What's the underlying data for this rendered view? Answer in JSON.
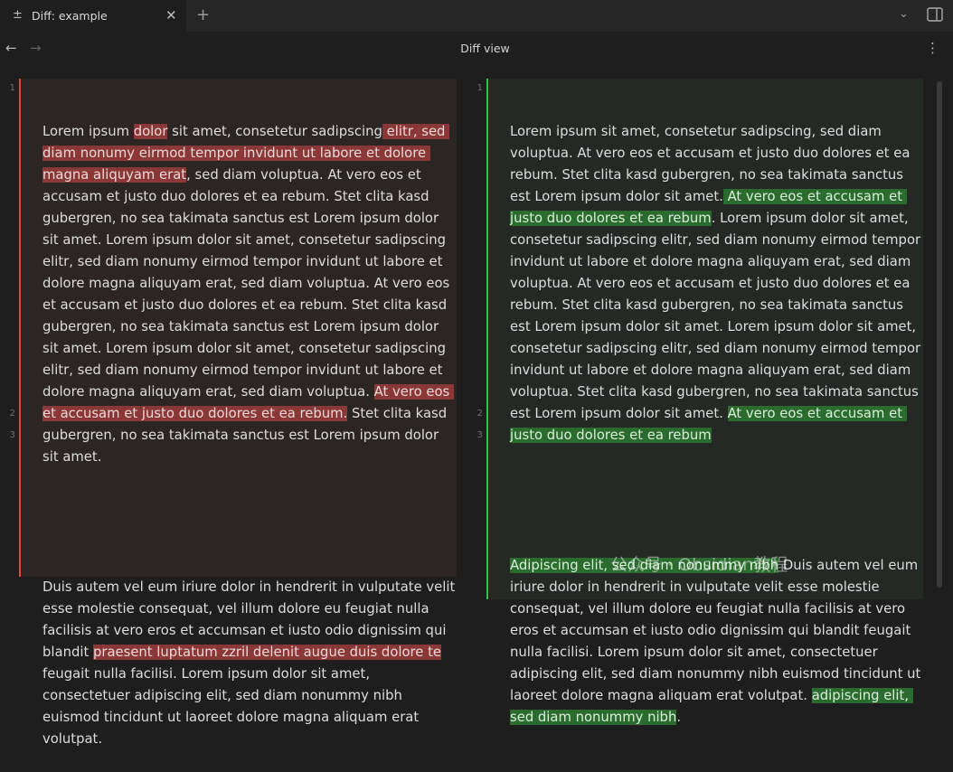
{
  "tab": {
    "icon": "plus-minus-icon",
    "icon_glyph": "±",
    "title": "Diff: example",
    "close_glyph": "✕",
    "new_glyph": "+"
  },
  "tabbar": {
    "menu_icon": "chevron-down-icon",
    "menu_glyph": "⌄",
    "sidebar_icon": "sidebar-toggle-icon"
  },
  "header": {
    "title": "Diff view",
    "back_glyph": "←",
    "forward_glyph": "→",
    "more_glyph": "⋮"
  },
  "gutter": {
    "line1": "1",
    "line2": "2",
    "line3": "3"
  },
  "left": {
    "p1": [
      {
        "t": "Lorem ipsum "
      },
      {
        "t": "dolor",
        "d": true
      },
      {
        "t": " sit amet, consetetur sadipscing"
      },
      {
        "t": " elitr, sed diam nonumy eirmod tempor invidunt ut labore et dolore magna aliquyam erat",
        "d": true
      },
      {
        "t": ", sed diam voluptua. At vero eos et accusam et justo duo dolores et ea rebum. Stet clita kasd gubergren, no sea takimata sanctus est Lorem ipsum dolor sit amet. Lorem ipsum dolor sit amet, consetetur sadipscing elitr, sed diam nonumy eirmod tempor invidunt ut labore et dolore magna aliquyam erat, sed diam voluptua. At vero eos et accusam et justo duo dolores et ea rebum. Stet clita kasd gubergren, no sea takimata sanctus est Lorem ipsum dolor sit amet. Lorem ipsum dolor sit amet, consetetur sadipscing elitr, sed diam nonumy eirmod tempor invidunt ut labore et dolore magna aliquyam erat, sed diam voluptua. "
      },
      {
        "t": "At vero eos et accusam et justo duo dolores et ea rebum.",
        "d": true
      },
      {
        "t": " Stet clita kasd gubergren, no sea takimata sanctus est Lorem ipsum dolor sit amet."
      }
    ],
    "p3": [
      {
        "t": "Duis autem vel eum iriure dolor in hendrerit in vulputate velit esse molestie consequat, vel illum dolore eu feugiat nulla facilisis at vero eros et accumsan et iusto odio dignissim qui blandit "
      },
      {
        "t": "praesent luptatum zzril delenit augue duis dolore te",
        "d": true
      },
      {
        "t": " feugait nulla facilisi. Lorem ipsum dolor sit amet, consectetuer adipiscing elit, sed diam nonummy nibh euismod tincidunt ut laoreet dolore magna aliquam erat volutpat."
      }
    ]
  },
  "right": {
    "p1": [
      {
        "t": "Lorem ipsum sit amet, consetetur sadipscing, sed diam voluptua. At vero eos et accusam et justo duo dolores et ea rebum. Stet clita kasd gubergren, no sea takimata sanctus est Lorem ipsum dolor sit amet."
      },
      {
        "t": " At vero eos et accusam et justo duo dolores et ea rebum",
        "i": true
      },
      {
        "t": ". Lorem ipsum dolor sit amet, consetetur sadipscing elitr, sed diam nonumy eirmod tempor invidunt ut labore et dolore magna aliquyam erat, sed diam voluptua. At vero eos et accusam et justo duo dolores et ea rebum. Stet clita kasd gubergren, no sea takimata sanctus est Lorem ipsum dolor sit amet. Lorem ipsum dolor sit amet, consetetur sadipscing elitr, sed diam nonumy eirmod tempor invidunt ut labore et dolore magna aliquyam erat, sed diam voluptua. Stet clita kasd gubergren, no sea takimata sanctus est Lorem ipsum dolor sit amet. "
      },
      {
        "t": "At vero eos et accusam et justo duo dolores et ea rebum",
        "i": true
      }
    ],
    "p3": [
      {
        "t": "Adipiscing elit, sed diam nonummy nibh",
        "i": true
      },
      {
        "t": " Duis autem vel eum iriure dolor in hendrerit in vulputate velit esse molestie consequat, vel illum dolore eu feugiat nulla facilisis at vero eros et accumsan et iusto odio dignissim qui blandit feugait nulla facilisi. Lorem ipsum dolor sit amet, consectetuer adipiscing elit, sed diam nonummy nibh euismod tincidunt ut laoreet dolore magna aliquam erat volutpat. "
      },
      {
        "t": "adipiscing elit, sed diam nonummy nibh",
        "i": true
      },
      {
        "t": "."
      }
    ]
  },
  "watermark": "公众号 · Obsidian教程",
  "colors": {
    "deleted_bg": "#8a3837",
    "inserted_bg": "#2b6b2f",
    "deleted_bar": "#e0453f",
    "inserted_bar": "#36c046"
  }
}
